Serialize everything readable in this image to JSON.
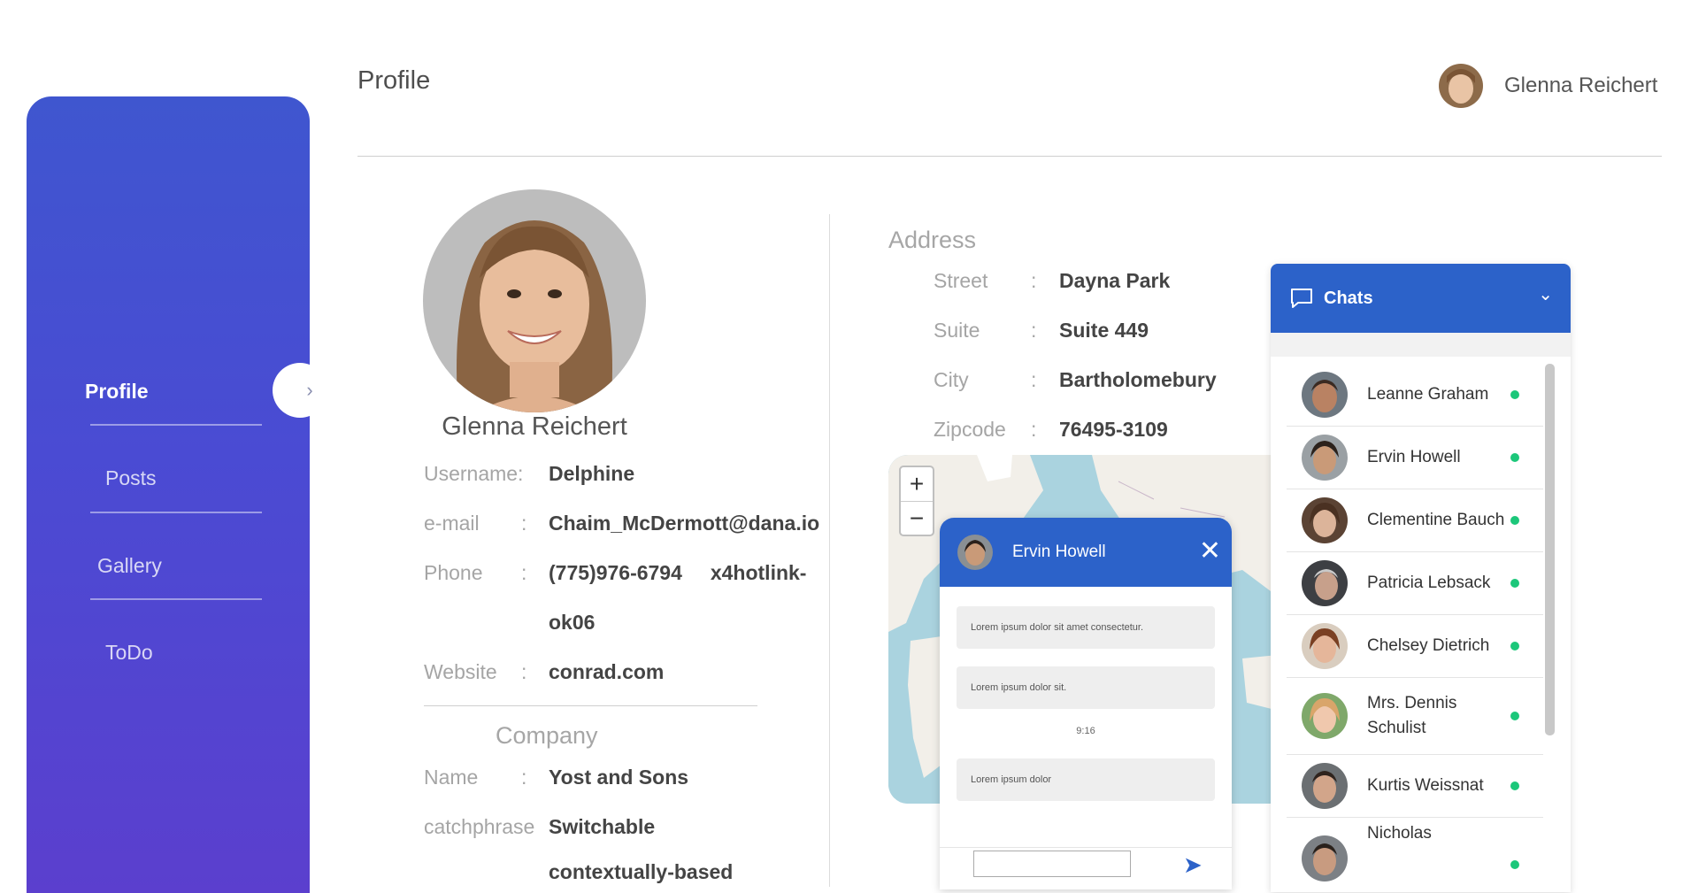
{
  "header": {
    "page_title": "Profile",
    "user_name": "Glenna Reichert"
  },
  "sidebar": {
    "items": [
      {
        "label": "Profile",
        "active": true
      },
      {
        "label": "Posts",
        "active": false
      },
      {
        "label": "Gallery",
        "active": false
      },
      {
        "label": "ToDo",
        "active": false
      }
    ],
    "toggle_icon": "chevron-right-icon"
  },
  "profile": {
    "name": "Glenna Reichert",
    "rows": [
      {
        "label": "Username",
        "sep": ":",
        "value": "Delphine"
      },
      {
        "label": "e-mail",
        "sep": ":",
        "value": "Chaim_McDermott@dana.io"
      },
      {
        "label": "Phone",
        "sep": ":",
        "value": "(775)976-6794     x4hotlink-",
        "value2": "ok06"
      },
      {
        "label": "Website",
        "sep": ":",
        "value": "conrad.com"
      }
    ],
    "company": {
      "title": "Company",
      "rows": [
        {
          "label": "Name",
          "sep": ":",
          "value": "Yost and Sons"
        },
        {
          "label": "catchphrase",
          "sep": "",
          "value": "Switchable",
          "value2": "contextually-based"
        }
      ]
    }
  },
  "address": {
    "title": "Address",
    "rows": [
      {
        "label": "Street",
        "sep": ":",
        "value": "Dayna Park"
      },
      {
        "label": "Suite",
        "sep": ":",
        "value": "Suite 449"
      },
      {
        "label": "City",
        "sep": ":",
        "value": "Bartholomebury"
      },
      {
        "label": "Zipcode",
        "sep": ":",
        "value": "76495-3109"
      }
    ]
  },
  "map": {
    "zoom_in": "+",
    "zoom_out": "−"
  },
  "chat_window": {
    "contact_name": "Ervin Howell",
    "close": "✕",
    "messages": [
      "Lorem ipsum dolor sit amet consectetur.",
      "Lorem ipsum dolor sit.",
      "Lorem ipsum dolor"
    ],
    "time": "9:16",
    "input_value": "",
    "send_icon": "send-icon"
  },
  "chats": {
    "title": "Chats",
    "icon": "chat-bubble-icon",
    "collapse_icon": "chevron-down-icon",
    "contacts": [
      {
        "name": "Leanne Graham",
        "online": true
      },
      {
        "name": "Ervin Howell",
        "online": true
      },
      {
        "name": "Clementine Bauch",
        "online": true
      },
      {
        "name": "Patricia Lebsack",
        "online": true
      },
      {
        "name": "Chelsey Dietrich",
        "online": true
      },
      {
        "name": "Mrs. Dennis Schulist",
        "online": true
      },
      {
        "name": "Kurtis Weissnat",
        "online": true
      },
      {
        "name": "Nicholas",
        "online": true
      }
    ],
    "status_color": "#1cc77a"
  },
  "colors": {
    "brand_blue": "#2c62c9",
    "sidebar_top": "#3f56cf",
    "sidebar_bottom": "#5b3fce"
  }
}
